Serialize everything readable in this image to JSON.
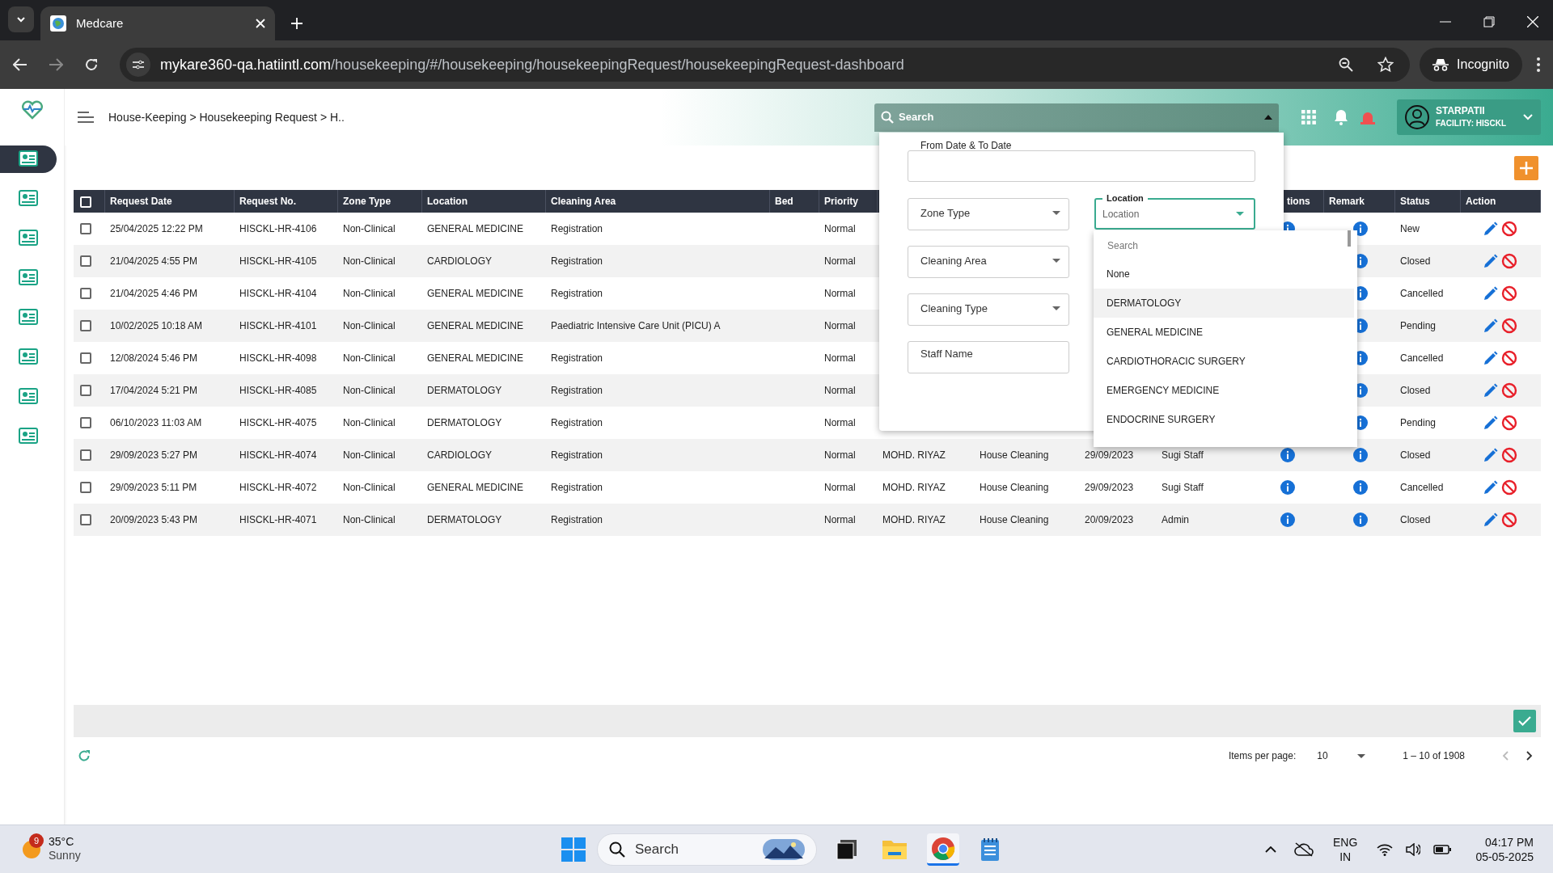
{
  "browser": {
    "tab_title": "Medcare",
    "url_host": "mykare360-qa.hatiintl.com",
    "url_path": "/housekeeping/#/housekeeping/housekeepingRequest/housekeepingRequest-dashboard",
    "incognito": "Incognito"
  },
  "sidebar": {
    "items": [
      {
        "selected": true
      },
      {
        "selected": false
      },
      {
        "selected": false
      },
      {
        "selected": false
      },
      {
        "selected": false
      },
      {
        "selected": false
      },
      {
        "selected": false
      },
      {
        "selected": false
      }
    ]
  },
  "header": {
    "breadcrumb": "House-Keeping > Housekeeping Request > H..",
    "search_placeholder": "Search",
    "user_name": "STARPATII",
    "facility": "FACILITY: HISCKL"
  },
  "filter_panel": {
    "date_label": "From Date & To Date",
    "selects": [
      {
        "label": "Zone Type"
      },
      {
        "label": "Cleaning Area"
      },
      {
        "label": "Cleaning Type"
      }
    ],
    "staff_placeholder": "Staff Name",
    "location": {
      "label": "Location",
      "placeholder": "Location",
      "search_placeholder": "Search",
      "options": [
        {
          "label": "None",
          "highlighted": false
        },
        {
          "label": "DERMATOLOGY",
          "highlighted": true
        },
        {
          "label": "GENERAL MEDICINE",
          "highlighted": false
        },
        {
          "label": "CARDIOTHORACIC SURGERY",
          "highlighted": false
        },
        {
          "label": "EMERGENCY MEDICINE",
          "highlighted": false
        },
        {
          "label": "ENDOCRINE SURGERY",
          "highlighted": false
        }
      ]
    }
  },
  "table": {
    "select_all_checked": false,
    "columns": {
      "request_date": "Request Date",
      "request_no": "Request No.",
      "zone_type": "Zone Type",
      "location": "Location",
      "cleaning_area": "Cleaning Area",
      "bed": "Bed",
      "priority": "Priority",
      "actions": "tions",
      "remark": "Remark",
      "status": "Status",
      "action": "Action"
    },
    "rows": [
      {
        "checked": false,
        "request_date": "25/04/2025 12:22 PM",
        "request_no": "HISCKL-HR-4106",
        "zone_type": "Non-Clinical",
        "location": "GENERAL MEDICINE",
        "cleaning_area": "Registration",
        "priority": "Normal",
        "status": "New"
      },
      {
        "checked": false,
        "request_date": "21/04/2025 4:55 PM",
        "request_no": "HISCKL-HR-4105",
        "zone_type": "Non-Clinical",
        "location": "CARDIOLOGY",
        "cleaning_area": "Registration",
        "priority": "Normal",
        "status": "Closed"
      },
      {
        "checked": false,
        "request_date": "21/04/2025 4:46 PM",
        "request_no": "HISCKL-HR-4104",
        "zone_type": "Non-Clinical",
        "location": "GENERAL MEDICINE",
        "cleaning_area": "Registration",
        "priority": "Normal",
        "status": "Cancelled"
      },
      {
        "checked": false,
        "request_date": "10/02/2025 10:18 AM",
        "request_no": "HISCKL-HR-4101",
        "zone_type": "Non-Clinical",
        "location": "GENERAL MEDICINE",
        "cleaning_area": "Paediatric Intensive Care Unit (PICU) A",
        "priority": "Normal",
        "status": "Pending"
      },
      {
        "checked": false,
        "request_date": "12/08/2024 5:46 PM",
        "request_no": "HISCKL-HR-4098",
        "zone_type": "Non-Clinical",
        "location": "GENERAL MEDICINE",
        "cleaning_area": "Registration",
        "priority": "Normal",
        "status": "Cancelled"
      },
      {
        "checked": false,
        "request_date": "17/04/2024 5:21 PM",
        "request_no": "HISCKL-HR-4085",
        "zone_type": "Non-Clinical",
        "location": "DERMATOLOGY",
        "cleaning_area": "Registration",
        "priority": "Normal",
        "status": "Closed"
      },
      {
        "checked": false,
        "request_date": "06/10/2023 11:03 AM",
        "request_no": "HISCKL-HR-4075",
        "zone_type": "Non-Clinical",
        "location": "DERMATOLOGY",
        "cleaning_area": "Registration",
        "priority": "Normal",
        "status": "Pending"
      },
      {
        "checked": false,
        "request_date": "29/09/2023 5:27 PM",
        "request_no": "HISCKL-HR-4074",
        "zone_type": "Non-Clinical",
        "location": "CARDIOLOGY",
        "cleaning_area": "Registration",
        "priority": "Normal",
        "staff": "MOHD. RIYAZ",
        "cleaning_type": "House Cleaning",
        "date": "29/09/2023",
        "requester": "Sugi Staff",
        "status": "Closed"
      },
      {
        "checked": false,
        "request_date": "29/09/2023 5:11 PM",
        "request_no": "HISCKL-HR-4072",
        "zone_type": "Non-Clinical",
        "location": "GENERAL MEDICINE",
        "cleaning_area": "Registration",
        "priority": "Normal",
        "staff": "MOHD. RIYAZ",
        "cleaning_type": "House Cleaning",
        "date": "29/09/2023",
        "requester": "Sugi Staff",
        "status": "Cancelled"
      },
      {
        "checked": false,
        "request_date": "20/09/2023 5:43 PM",
        "request_no": "HISCKL-HR-4071",
        "zone_type": "Non-Clinical",
        "location": "DERMATOLOGY",
        "cleaning_area": "Registration",
        "priority": "Normal",
        "staff": "MOHD. RIYAZ",
        "cleaning_type": "House Cleaning",
        "date": "20/09/2023",
        "requester": "Admin",
        "status": "Closed"
      }
    ]
  },
  "pagination": {
    "items_per_page_label": "Items per page:",
    "items_per_page": "10",
    "range": "1 – 10 of 1908"
  },
  "taskbar": {
    "temperature": "35°C",
    "weather": "Sunny",
    "weather_badge": "9",
    "search_placeholder": "Search",
    "language": "ENG",
    "region": "IN",
    "time": "04:17 PM",
    "date": "05-05-2025"
  }
}
